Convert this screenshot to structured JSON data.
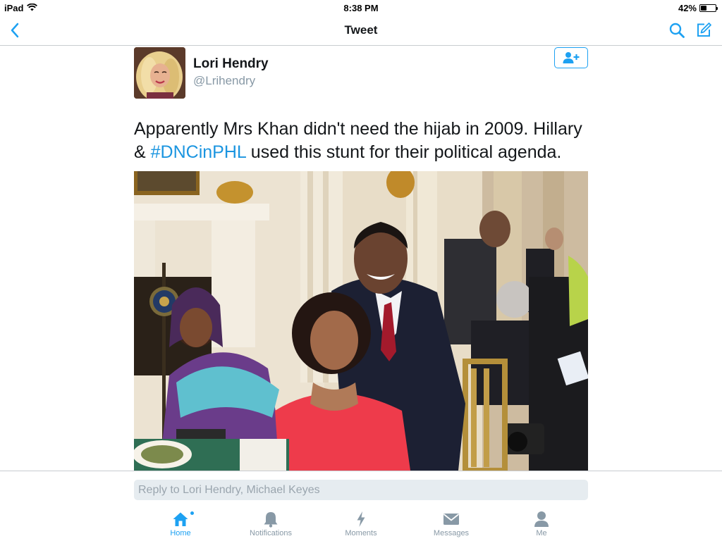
{
  "status_bar": {
    "device": "iPad",
    "time": "8:38 PM",
    "battery_percent": "42%",
    "battery_level": 0.42
  },
  "nav": {
    "title": "Tweet",
    "back_icon": "chevron-left-icon",
    "search_icon": "search-icon",
    "compose_icon": "compose-icon"
  },
  "tweet": {
    "author_name": "Lori Hendry",
    "author_handle": "@Lrihendry",
    "follow_icon": "add-user-icon",
    "text_before": "Apparently Mrs Khan didn't need the hijab in 2009.  Hillary & ",
    "hashtag": "#DNCinPHL",
    "text_after": " used this stunt for their political agenda."
  },
  "reply": {
    "placeholder": "Reply to Lori Hendry, Michael Keyes"
  },
  "tabs": [
    {
      "label": "Home",
      "icon": "home-icon",
      "active": true
    },
    {
      "label": "Notifications",
      "icon": "bell-icon",
      "active": false
    },
    {
      "label": "Moments",
      "icon": "lightning-icon",
      "active": false
    },
    {
      "label": "Messages",
      "icon": "envelope-icon",
      "active": false
    },
    {
      "label": "Me",
      "icon": "person-icon",
      "active": false
    }
  ],
  "colors": {
    "accent": "#1da1f2",
    "link": "#1b95e0",
    "text": "#14171a",
    "muted": "#8899a6"
  }
}
